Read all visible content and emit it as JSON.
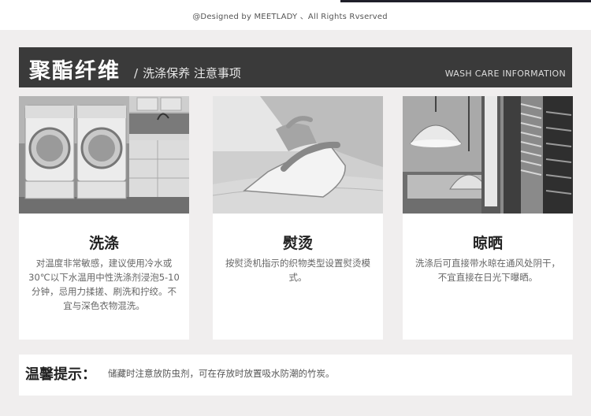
{
  "header": {
    "copyright": "@Designed by MEETLADY 、All Rights Rvserved"
  },
  "banner": {
    "title": "聚酯纤维",
    "slash": "/",
    "subtitle": "洗涤保养 注意事项",
    "english": "WASH CARE INFORMATION",
    "background": "#3a3a3a"
  },
  "cards": [
    {
      "image": "washing-machines-photo",
      "title": "洗涤",
      "description": "对温度非常敏感，建议使用冷水或30℃以下水温用中性洗涤剂浸泡5-10分钟，忌用力揉搓、刷洗和拧绞。不宜与深色衣物混洗。"
    },
    {
      "image": "iron-photo",
      "title": "熨烫",
      "description": "按熨烫机指示的织物类型设置熨烫模式。"
    },
    {
      "image": "hanging-clothes-photo",
      "title": "晾晒",
      "description": "洗涤后可直接带水晾在通风处阴干，不宜直接在日光下曝晒。"
    }
  ],
  "tip": {
    "label": "温馨提示：",
    "text": "储藏时注意放防虫剂，可在存放时放置吸水防潮的竹炭。"
  }
}
